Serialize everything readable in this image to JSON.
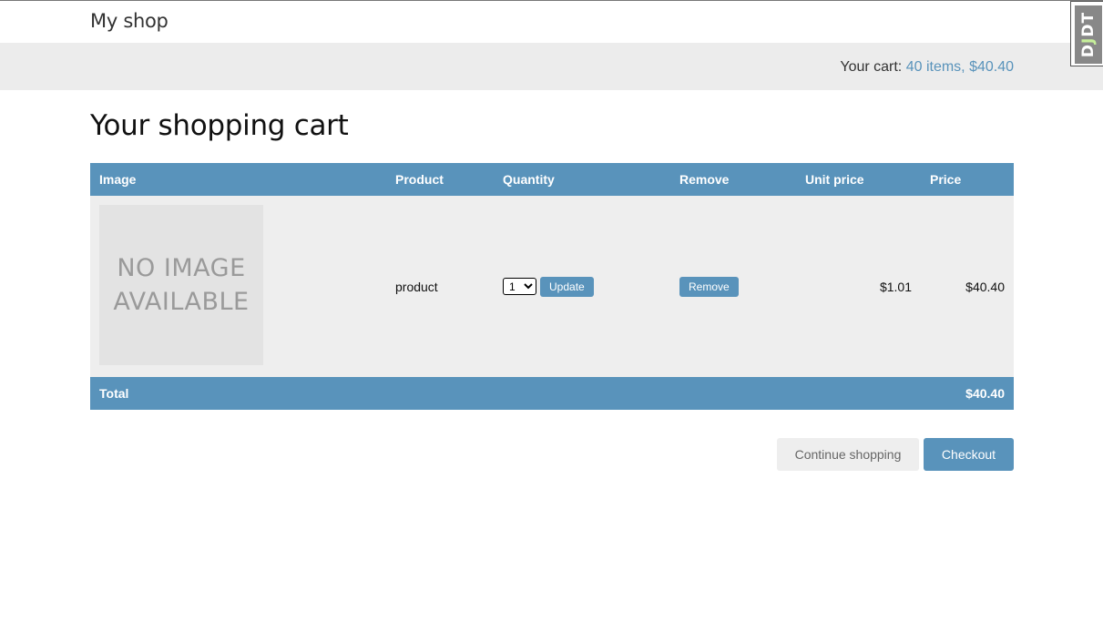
{
  "header": {
    "logo": "My shop"
  },
  "subheader": {
    "cart_label": "Your cart: ",
    "cart_link": "40 items, $40.40"
  },
  "page": {
    "title": "Your shopping cart"
  },
  "table": {
    "headers": [
      "Image",
      "Product",
      "Quantity",
      "Remove",
      "Unit price",
      "Price"
    ],
    "rows": [
      {
        "image_text_line1": "NO IMAGE",
        "image_text_line2": "AVAILABLE",
        "product": "product",
        "quantity": "1",
        "update_label": "Update",
        "remove_label": "Remove",
        "unit_price": "$1.01",
        "price": "$40.40"
      }
    ],
    "total_label": "Total",
    "total_value": "$40.40"
  },
  "actions": {
    "continue_label": "Continue shopping",
    "checkout_label": "Checkout"
  },
  "debug_toolbar": {
    "text_d": "D",
    "text_j": "J",
    "text_dt": "DT"
  },
  "colors": {
    "accent": "#5993bb",
    "band": "#ececec",
    "row_bg": "#eeeeee"
  }
}
